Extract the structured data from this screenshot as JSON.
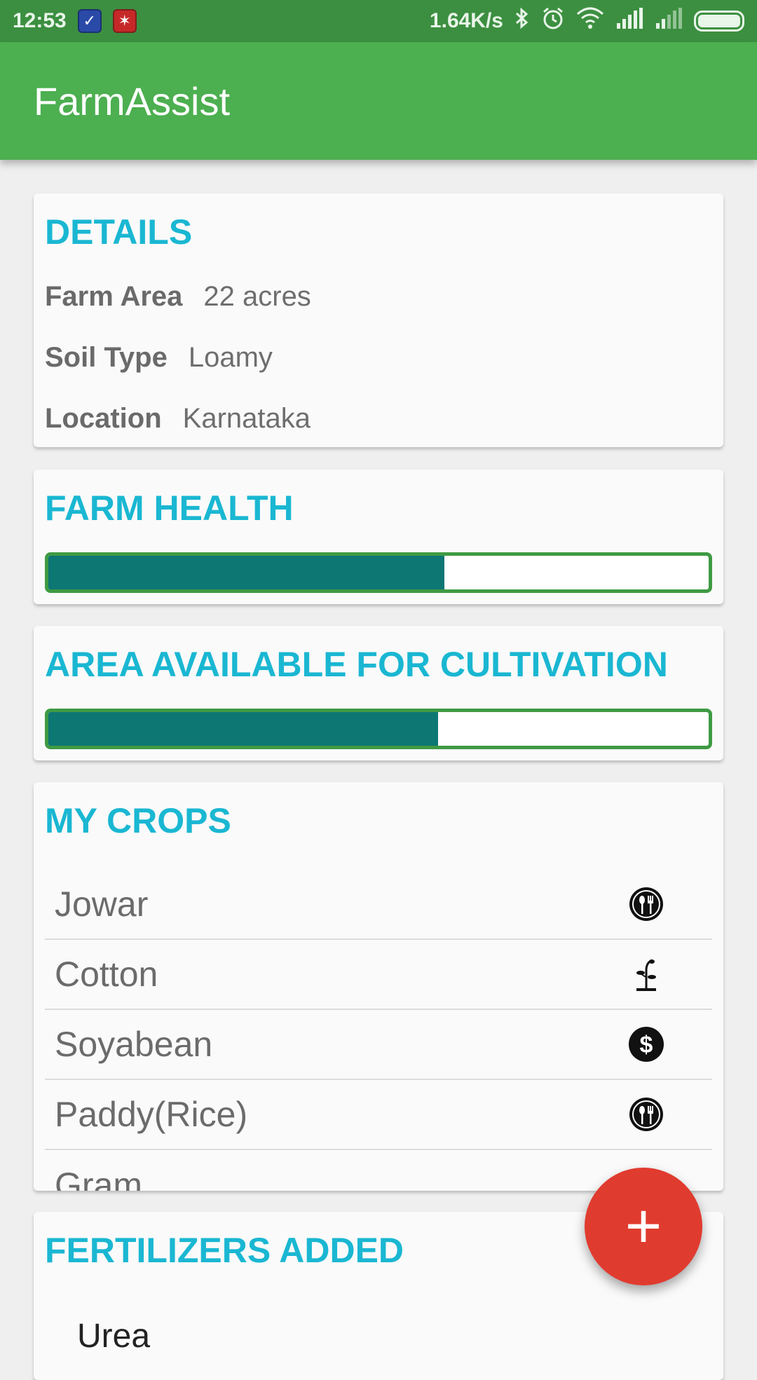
{
  "status_bar": {
    "time": "12:53",
    "network_speed": "1.64K/s",
    "icons": [
      "mail-app-icon",
      "red-app-icon",
      "bluetooth-icon",
      "alarm-icon",
      "wifi-icon",
      "signal-icon",
      "signal-icon-2",
      "battery-icon"
    ]
  },
  "app_bar": {
    "title": "FarmAssist"
  },
  "details": {
    "title": "DETAILS",
    "rows": [
      {
        "label": "Farm Area",
        "value": "22 acres"
      },
      {
        "label": "Soil Type",
        "value": "Loamy"
      },
      {
        "label": "Location",
        "value": "Karnataka"
      }
    ]
  },
  "farm_health": {
    "title": "FARM HEALTH",
    "progress_percent": 60
  },
  "area_available": {
    "title": "AREA AVAILABLE FOR CULTIVATION",
    "progress_percent": 59
  },
  "my_crops": {
    "title": "MY CROPS",
    "items": [
      {
        "name": "Jowar",
        "icon": "food-icon"
      },
      {
        "name": "Cotton",
        "icon": "plant-icon"
      },
      {
        "name": "Soyabean",
        "icon": "dollar-icon"
      },
      {
        "name": "Paddy(Rice)",
        "icon": "food-icon"
      },
      {
        "name": "Gram",
        "icon": "food-icon"
      }
    ]
  },
  "fertilizers": {
    "title": "FERTILIZERS ADDED",
    "items": [
      {
        "name": "Urea"
      }
    ]
  },
  "fab": {
    "label": "+",
    "icon": "add-icon"
  },
  "colors": {
    "accent": "#1ab7d2",
    "app_bar": "#4caf50",
    "status_bar": "#3c8f40",
    "progress_fill": "#0d7773",
    "fab": "#e03b2f"
  }
}
